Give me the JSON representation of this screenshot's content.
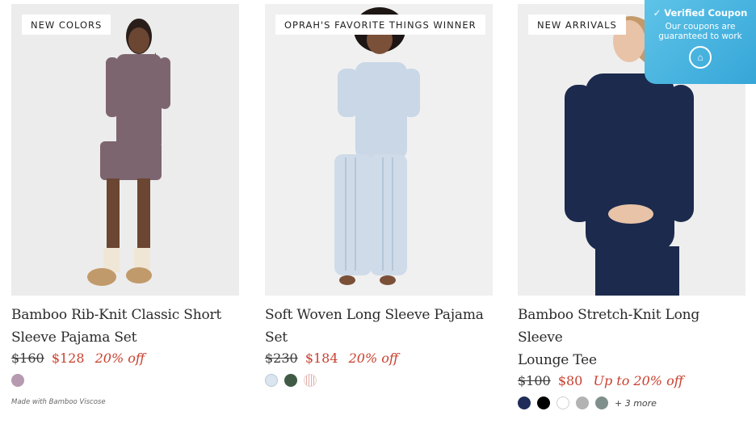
{
  "products": [
    {
      "badge": "NEW COLORS",
      "title_line1": "Bamboo Rib-Knit Classic Short",
      "title_line2": "Sleeve Pajama Set",
      "price_original": "$160",
      "price_sale": "$128",
      "discount": "20% off",
      "swatches": [
        "#b59ab0"
      ],
      "image_alt": "Woman wearing mauve short sleeve pajama set"
    },
    {
      "badge": "OPRAH'S FAVORITE THINGS WINNER",
      "title_line1": "Soft Woven Long Sleeve Pajama",
      "title_line2": "Set",
      "price_original": "$230",
      "price_sale": "$184",
      "discount": "20% off",
      "swatches": [
        "#cfdbe8",
        "#3f5a45",
        "#e8c9c6"
      ],
      "image_alt": "Woman wearing light blue striped pajama set"
    },
    {
      "badge": "NEW ARRIVALS",
      "title_line1": "Bamboo Stretch-Knit Long Sleeve",
      "title_line2": "Lounge Tee",
      "price_original": "$100",
      "price_sale": "$80",
      "discount": "Up to 20% off",
      "swatches": [
        "#1f2d58",
        "#000000",
        "#ffffff",
        "#b3b3b3",
        "#7f908c"
      ],
      "more_colors": "+ 3 more",
      "image_alt": "Woman wearing navy long sleeve lounge tee"
    }
  ],
  "material_note": "Made with Bamboo Viscose",
  "coupon": {
    "heading": "Verified Coupon",
    "subtext_line1": "Our coupons are",
    "subtext_line2": "guaranteed to work"
  }
}
